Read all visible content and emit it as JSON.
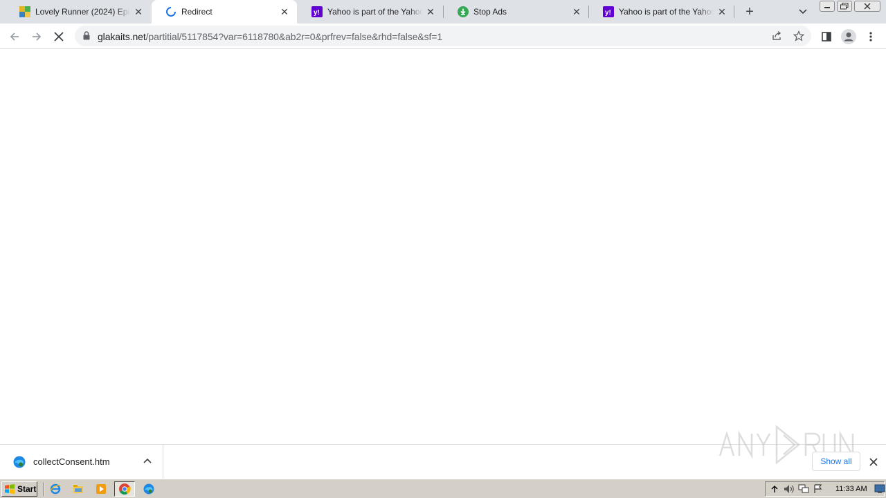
{
  "tabs": [
    {
      "title": "Lovely Runner (2024) Episode 1",
      "favicon": "drama-site-icon",
      "active": false
    },
    {
      "title": "Redirect",
      "favicon": "loading-spinner-icon",
      "active": true
    },
    {
      "title": "Yahoo is part of the Yahoo family",
      "favicon": "yahoo-icon",
      "active": false
    },
    {
      "title": "Stop Ads",
      "favicon": "download-green-icon",
      "active": false
    },
    {
      "title": "Yahoo is part of the Yahoo family",
      "favicon": "yahoo-icon",
      "active": false
    }
  ],
  "tab_close_glyph": "✕",
  "new_tab_glyph": "+",
  "address": {
    "host": "glakaits.net",
    "path": "/partitial/5117854?var=6118780&ab2r=0&prfrev=false&rhd=false&sf=1"
  },
  "download": {
    "filename": "collectConsent.htm",
    "show_all_label": "Show all"
  },
  "taskbar": {
    "start_label": "Start",
    "clock": "11:33 AM"
  },
  "colors": {
    "tabstrip_bg": "#dee1e6",
    "yahoo_purple": "#6001d2",
    "stop_ads_green": "#34a853",
    "link_blue": "#1a73e8",
    "taskbar_gray": "#d4d0c8"
  }
}
